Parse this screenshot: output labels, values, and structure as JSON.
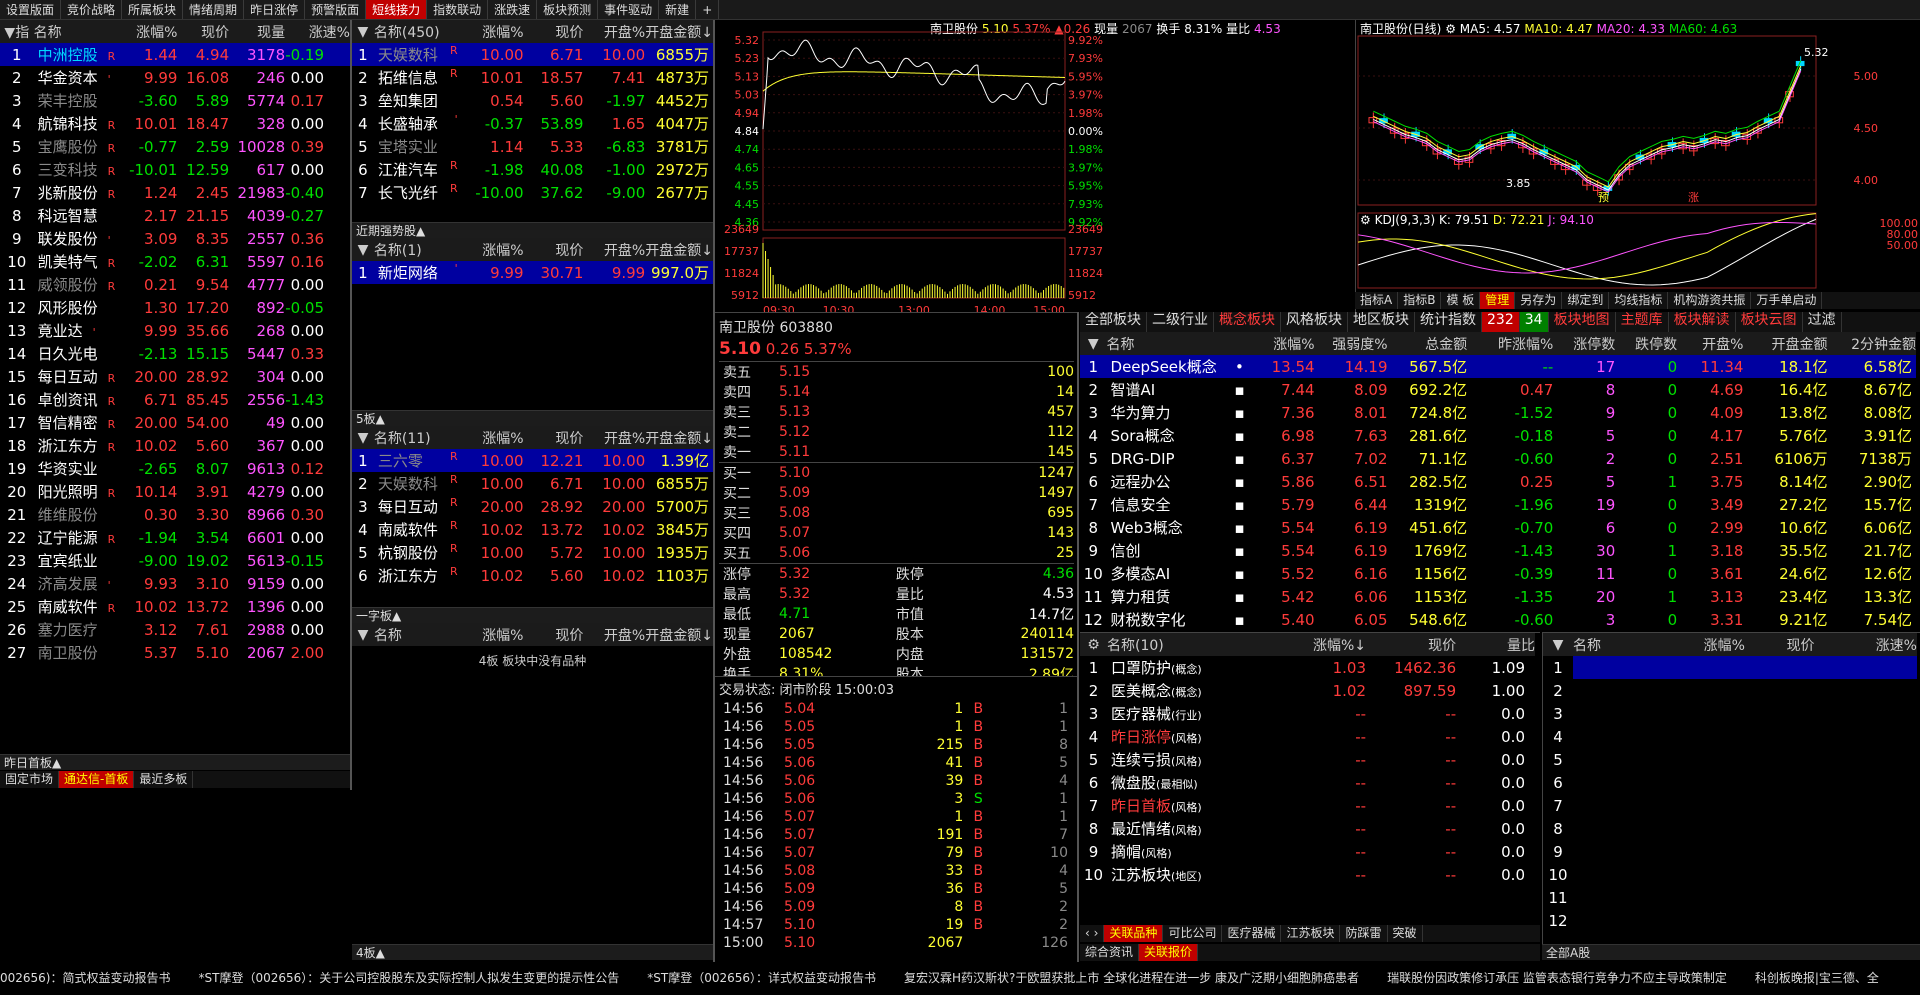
{
  "top_menu": [
    "设置版面",
    "竞价战略",
    "所属板块",
    "情绪周期",
    "昨日涨停",
    "预警版面",
    "短线接力",
    "指数联动",
    "涨跌速",
    "板块预测",
    "事件驱动",
    "新建",
    "+"
  ],
  "left": {
    "headers": [
      "▼指",
      "名称",
      "涨幅%",
      "现价",
      "现量",
      "涨速%"
    ],
    "rows": [
      {
        "i": "1",
        "n": "中洲控股",
        "f": "R",
        "p": "1.44",
        "c": "4.94",
        "v": "3178",
        "s": "-0.19",
        "nc": "cyan",
        "pc": "red",
        "sc": "grn",
        "sel": true
      },
      {
        "i": "2",
        "n": "华金资本",
        "f": "'",
        "p": "9.99",
        "c": "16.08",
        "v": "246",
        "s": "0.00",
        "nc": "wht",
        "pc": "red",
        "sc": "wht"
      },
      {
        "i": "3",
        "n": "荣丰控股",
        "f": "",
        "p": "-3.60",
        "c": "5.89",
        "v": "5774",
        "s": "0.17",
        "nc": "gry",
        "pc": "grn",
        "sc": "red"
      },
      {
        "i": "4",
        "n": "航锦科技",
        "f": "R",
        "p": "10.01",
        "c": "18.47",
        "v": "328",
        "s": "0.00",
        "nc": "wht",
        "pc": "red",
        "sc": "wht"
      },
      {
        "i": "5",
        "n": "宝鹰股份",
        "f": "R",
        "p": "-0.77",
        "c": "2.59",
        "v": "10028",
        "s": "0.39",
        "nc": "gry",
        "pc": "grn",
        "sc": "red"
      },
      {
        "i": "6",
        "n": "三变科技",
        "f": "R",
        "p": "-10.01",
        "c": "12.59",
        "v": "617",
        "s": "0.00",
        "nc": "gry",
        "pc": "grn",
        "sc": "wht"
      },
      {
        "i": "7",
        "n": "兆新股份",
        "f": "R",
        "p": "1.24",
        "c": "2.45",
        "v": "21983",
        "s": "-0.40",
        "nc": "wht",
        "pc": "red",
        "sc": "grn"
      },
      {
        "i": "8",
        "n": "科远智慧",
        "f": "",
        "p": "2.17",
        "c": "21.15",
        "v": "4039",
        "s": "-0.27",
        "nc": "wht",
        "pc": "red",
        "sc": "grn"
      },
      {
        "i": "9",
        "n": "联发股份",
        "f": "'",
        "p": "3.09",
        "c": "8.35",
        "v": "2557",
        "s": "0.36",
        "nc": "wht",
        "pc": "red",
        "sc": "red"
      },
      {
        "i": "10",
        "n": "凯美特气",
        "f": "R",
        "p": "-2.02",
        "c": "6.31",
        "v": "5597",
        "s": "0.16",
        "nc": "wht",
        "pc": "grn",
        "sc": "red"
      },
      {
        "i": "11",
        "n": "威领股份",
        "f": "R",
        "p": "0.21",
        "c": "9.54",
        "v": "4777",
        "s": "0.00",
        "nc": "gry",
        "pc": "red",
        "sc": "wht"
      },
      {
        "i": "12",
        "n": "风形股份",
        "f": "",
        "p": "1.30",
        "c": "17.20",
        "v": "892",
        "s": "-0.05",
        "nc": "wht",
        "pc": "red",
        "sc": "grn"
      },
      {
        "i": "13",
        "n": "竟业达",
        "f": "'",
        "p": "9.99",
        "c": "35.66",
        "v": "268",
        "s": "0.00",
        "nc": "wht",
        "pc": "red",
        "sc": "wht"
      },
      {
        "i": "14",
        "n": "日久光电",
        "f": "",
        "p": "-2.13",
        "c": "15.15",
        "v": "5447",
        "s": "0.33",
        "nc": "wht",
        "pc": "grn",
        "sc": "red"
      },
      {
        "i": "15",
        "n": "每日互动",
        "f": "R",
        "p": "20.00",
        "c": "28.92",
        "v": "304",
        "s": "0.00",
        "nc": "wht",
        "pc": "red",
        "sc": "wht"
      },
      {
        "i": "16",
        "n": "卓创资讯",
        "f": "R",
        "p": "6.71",
        "c": "85.45",
        "v": "2556",
        "s": "-1.43",
        "nc": "wht",
        "pc": "red",
        "sc": "grn"
      },
      {
        "i": "17",
        "n": "智信精密",
        "f": "R",
        "p": "20.00",
        "c": "54.00",
        "v": "49",
        "s": "0.00",
        "nc": "wht",
        "pc": "red",
        "sc": "wht"
      },
      {
        "i": "18",
        "n": "浙江东方",
        "f": "R",
        "p": "10.02",
        "c": "5.60",
        "v": "367",
        "s": "0.00",
        "nc": "wht",
        "pc": "red",
        "sc": "wht"
      },
      {
        "i": "19",
        "n": "华资实业",
        "f": "",
        "p": "-2.65",
        "c": "8.07",
        "v": "9613",
        "s": "0.12",
        "nc": "wht",
        "pc": "grn",
        "sc": "red"
      },
      {
        "i": "20",
        "n": "阳光照明",
        "f": "R",
        "p": "10.14",
        "c": "3.91",
        "v": "4279",
        "s": "0.00",
        "nc": "wht",
        "pc": "red",
        "sc": "wht"
      },
      {
        "i": "21",
        "n": "维维股份",
        "f": "",
        "p": "0.30",
        "c": "3.30",
        "v": "8966",
        "s": "0.30",
        "nc": "gry",
        "pc": "red",
        "sc": "red"
      },
      {
        "i": "22",
        "n": "辽宁能源",
        "f": "R",
        "p": "-1.94",
        "c": "3.54",
        "v": "6601",
        "s": "0.00",
        "nc": "wht",
        "pc": "grn",
        "sc": "wht"
      },
      {
        "i": "23",
        "n": "宜宾纸业",
        "f": "",
        "p": "-9.00",
        "c": "19.02",
        "v": "5613",
        "s": "-0.15",
        "nc": "wht",
        "pc": "grn",
        "sc": "grn"
      },
      {
        "i": "24",
        "n": "济高发展",
        "f": "'",
        "p": "9.93",
        "c": "3.10",
        "v": "9159",
        "s": "0.00",
        "nc": "gry",
        "pc": "red",
        "sc": "wht"
      },
      {
        "i": "25",
        "n": "南威软件",
        "f": "R",
        "p": "10.02",
        "c": "13.72",
        "v": "1396",
        "s": "0.00",
        "nc": "wht",
        "pc": "red",
        "sc": "wht"
      },
      {
        "i": "26",
        "n": "塞力医疗",
        "f": "",
        "p": "3.12",
        "c": "7.61",
        "v": "2988",
        "s": "0.00",
        "nc": "gry",
        "pc": "red",
        "sc": "wht"
      },
      {
        "i": "27",
        "n": "南卫股份",
        "f": "",
        "p": "5.37",
        "c": "5.10",
        "v": "2067",
        "s": "2.00",
        "nc": "gry",
        "pc": "red",
        "sc": "red"
      }
    ],
    "section_label": "昨日首板▲",
    "tabs": [
      "固定市场",
      "通达信-首板",
      "最近多板"
    ]
  },
  "mid": {
    "p1_headers": [
      "▼",
      "名称(450)",
      "涨幅%",
      "现价",
      "开盘%",
      "开盘金额↓"
    ],
    "p1_rows": [
      {
        "i": "1",
        "n": "天娱数科",
        "f": "R",
        "p": "10.00",
        "c": "6.71",
        "o": "10.00",
        "a": "6855万",
        "nc": "gry",
        "pc": "red",
        "oc": "red",
        "sel": true
      },
      {
        "i": "2",
        "n": "拓维信息",
        "f": "R",
        "p": "10.01",
        "c": "18.57",
        "o": "7.41",
        "a": "4873万",
        "nc": "wht",
        "pc": "red",
        "oc": "red"
      },
      {
        "i": "3",
        "n": "垒知集团",
        "f": "",
        "p": "0.54",
        "c": "5.60",
        "o": "-1.97",
        "a": "4452万",
        "nc": "wht",
        "pc": "red",
        "oc": "grn"
      },
      {
        "i": "4",
        "n": "长盛轴承",
        "f": "'",
        "p": "-0.37",
        "c": "53.89",
        "o": "1.65",
        "a": "4047万",
        "nc": "wht",
        "pc": "grn",
        "oc": "red"
      },
      {
        "i": "5",
        "n": "宝塔实业",
        "f": "",
        "p": "1.14",
        "c": "5.33",
        "o": "-6.83",
        "a": "3781万",
        "nc": "gry",
        "pc": "red",
        "oc": "grn"
      },
      {
        "i": "6",
        "n": "江淮汽车",
        "f": "R",
        "p": "-1.98",
        "c": "40.08",
        "o": "-1.00",
        "a": "2972万",
        "nc": "wht",
        "pc": "grn",
        "oc": "grn"
      },
      {
        "i": "7",
        "n": "长飞光纤",
        "f": "R",
        "p": "-10.00",
        "c": "37.62",
        "o": "-9.00",
        "a": "2677万",
        "nc": "wht",
        "pc": "grn",
        "oc": "grn"
      }
    ],
    "s2_label": "近期强势股▲",
    "p2_headers": [
      "▼",
      "名称(1)",
      "涨幅%",
      "现价",
      "开盘%",
      "开盘金额↓"
    ],
    "p2_rows": [
      {
        "i": "1",
        "n": "新炬网络",
        "f": "'",
        "p": "9.99",
        "c": "30.71",
        "o": "9.99",
        "a": "997.0万",
        "nc": "wht",
        "pc": "red",
        "oc": "red",
        "sel": true
      }
    ],
    "s3_label": "5板▲",
    "p3_headers": [
      "▼",
      "名称(11)",
      "涨幅%",
      "现价",
      "开盘%",
      "开盘金额↓"
    ],
    "p3_rows": [
      {
        "i": "1",
        "n": "三六零",
        "f": "R",
        "p": "10.00",
        "c": "12.21",
        "o": "10.00",
        "a": "1.39亿",
        "nc": "gry",
        "pc": "red",
        "oc": "red",
        "sel": true
      },
      {
        "i": "2",
        "n": "天娱数科",
        "f": "R",
        "p": "10.00",
        "c": "6.71",
        "o": "10.00",
        "a": "6855万",
        "nc": "gry",
        "pc": "red",
        "oc": "red"
      },
      {
        "i": "3",
        "n": "每日互动",
        "f": "R",
        "p": "20.00",
        "c": "28.92",
        "o": "20.00",
        "a": "5700万",
        "nc": "wht",
        "pc": "red",
        "oc": "red"
      },
      {
        "i": "4",
        "n": "南威软件",
        "f": "R",
        "p": "10.02",
        "c": "13.72",
        "o": "10.02",
        "a": "3845万",
        "nc": "wht",
        "pc": "red",
        "oc": "red"
      },
      {
        "i": "5",
        "n": "杭钢股份",
        "f": "R",
        "p": "10.00",
        "c": "5.72",
        "o": "10.00",
        "a": "1935万",
        "nc": "wht",
        "pc": "red",
        "oc": "red"
      },
      {
        "i": "6",
        "n": "浙江东方",
        "f": "R",
        "p": "10.02",
        "c": "5.60",
        "o": "10.02",
        "a": "1103万",
        "nc": "wht",
        "pc": "red",
        "oc": "red"
      }
    ],
    "s4_label": "一字板▲",
    "p4_headers": [
      "▼",
      "名称",
      "涨幅%",
      "现价",
      "开盘%",
      "开盘金额↓"
    ],
    "p4_empty": "4板 板块中没有品种",
    "bottom_label": "4板▲"
  },
  "intraday": {
    "header": {
      "name": "南卫股份",
      "price": "5.10",
      "pct": "5.37%",
      "chg": "▲0.26",
      "vol_label": "现量",
      "vol": "2067",
      "turn_label": "换手",
      "turn": "8.31%",
      "qr_label": "量比",
      "qr": "4.53"
    },
    "left_ticks": [
      "5.32",
      "5.23",
      "5.13",
      "5.03",
      "4.94",
      "4.84",
      "4.74",
      "4.65",
      "4.55",
      "4.45",
      "4.36"
    ],
    "right_ticks": [
      "9.92%",
      "7.93%",
      "5.95%",
      "3.97%",
      "1.98%",
      "0.00%",
      "1.98%",
      "3.97%",
      "5.95%",
      "7.93%",
      "9.92%"
    ],
    "vol_ticks": [
      "23649",
      "17737",
      "11824",
      "5912"
    ],
    "times": [
      "09:30",
      "10:30",
      "13:00",
      "14:00",
      "15:00"
    ]
  },
  "kline": {
    "header": {
      "name": "南卫股份(日线)",
      "ma5": "MA5: 4.57",
      "ma10": "MA10: 4.47",
      "ma20": "MA20: 4.33",
      "ma60": "MA60: 4.63"
    },
    "ticks": [
      "5.00",
      "4.50",
      "4.00"
    ],
    "hi": "5.32",
    "lo": "3.85",
    "kdj": {
      "label": "KDJ(9,3,3)",
      "k": "K: 79.51",
      "d": "D: 72.21",
      "j": "J: 94.10"
    },
    "kdj_ticks": [
      "100.00",
      "80.00",
      "50.00"
    ],
    "year": "2024年",
    "day_tab": "日线",
    "mark_yu": "预",
    "mark_zhang": "涨",
    "mark_2": "2",
    "tabs": [
      "指标A",
      "指标B",
      "模 板",
      "管理",
      "另存为",
      "绑定到",
      "均线指标",
      "机构游资共振",
      "万手单启动"
    ]
  },
  "quote": {
    "title": "南卫股份 603880",
    "price": "5.10",
    "chg": "0.26",
    "pct": "5.37%",
    "asks": [
      [
        "卖五",
        "5.15",
        "100"
      ],
      [
        "卖四",
        "5.14",
        "14"
      ],
      [
        "卖三",
        "5.13",
        "457"
      ],
      [
        "卖二",
        "5.12",
        "112"
      ],
      [
        "卖一",
        "5.11",
        "145"
      ]
    ],
    "bids": [
      [
        "买一",
        "5.10",
        "1247"
      ],
      [
        "买二",
        "5.09",
        "1497"
      ],
      [
        "买三",
        "5.08",
        "695"
      ],
      [
        "买四",
        "5.07",
        "143"
      ],
      [
        "买五",
        "5.06",
        "25"
      ]
    ],
    "stats": [
      [
        "涨停",
        "5.32",
        "跌停",
        "4.36"
      ],
      [
        "最高",
        "5.32",
        "量比",
        "4.53"
      ],
      [
        "最低",
        "4.71",
        "市值",
        "14.7亿"
      ],
      [
        "现量",
        "2067",
        "股本",
        "240114"
      ],
      [
        "外盘",
        "108542",
        "内盘",
        "131572"
      ],
      [
        "换手",
        "8.31%",
        "股本",
        "2.89亿"
      ]
    ],
    "status": "交易状态: 闭市阶段 15:00:03",
    "trades": [
      [
        "14:56",
        "5.04",
        "1",
        "B",
        "1"
      ],
      [
        "14:56",
        "5.05",
        "1",
        "B",
        "1"
      ],
      [
        "14:56",
        "5.05",
        "215",
        "B",
        "8"
      ],
      [
        "14:56",
        "5.06",
        "41",
        "B",
        "5"
      ],
      [
        "14:56",
        "5.06",
        "39",
        "B",
        "4"
      ],
      [
        "14:56",
        "5.06",
        "3",
        "S",
        "1"
      ],
      [
        "14:56",
        "5.07",
        "1",
        "B",
        "1"
      ],
      [
        "14:56",
        "5.07",
        "191",
        "B",
        "7"
      ],
      [
        "14:56",
        "5.07",
        "79",
        "B",
        "10"
      ],
      [
        "14:56",
        "5.08",
        "33",
        "B",
        "4"
      ],
      [
        "14:56",
        "5.09",
        "36",
        "B",
        "5"
      ],
      [
        "14:56",
        "5.09",
        "8",
        "B",
        "2"
      ],
      [
        "14:57",
        "5.10",
        "19",
        "B",
        "2"
      ],
      [
        "15:00",
        "5.10",
        "2067",
        "",
        "126"
      ]
    ]
  },
  "sector": {
    "tabs": [
      "全部板块",
      "二级行业",
      "概念板块",
      "风格板块",
      "地区板块",
      "统计指数",
      "232",
      "34",
      "板块地图",
      "主题库",
      "板块解读",
      "板块云图",
      "过滤"
    ],
    "headers": [
      "▼",
      "名称",
      "",
      "涨幅%",
      "强弱度%",
      "总金额",
      "昨涨幅%",
      "涨停数",
      "跌停数",
      "开盘%",
      "开盘金额",
      "2分钟金额"
    ],
    "rows": [
      [
        "1",
        "DeepSeek概念",
        "13.54",
        "14.19",
        "567.5亿",
        "--",
        "17",
        "0",
        "11.34",
        "18.1亿",
        "6.58亿"
      ],
      [
        "2",
        "智谱AI",
        "7.44",
        "8.09",
        "692.2亿",
        "0.47",
        "8",
        "0",
        "4.69",
        "16.4亿",
        "8.67亿"
      ],
      [
        "3",
        "华为算力",
        "7.36",
        "8.01",
        "724.8亿",
        "-1.52",
        "9",
        "0",
        "4.09",
        "13.8亿",
        "8.08亿"
      ],
      [
        "4",
        "Sora概念",
        "6.98",
        "7.63",
        "281.6亿",
        "-0.18",
        "5",
        "0",
        "4.17",
        "5.76亿",
        "3.91亿"
      ],
      [
        "5",
        "DRG-DIP",
        "6.37",
        "7.02",
        "71.1亿",
        "-0.60",
        "2",
        "0",
        "2.51",
        "6106万",
        "7138万"
      ],
      [
        "6",
        "远程办公",
        "5.86",
        "6.51",
        "282.5亿",
        "0.25",
        "5",
        "1",
        "3.75",
        "8.14亿",
        "2.90亿"
      ],
      [
        "7",
        "信息安全",
        "5.79",
        "6.44",
        "1319亿",
        "-1.96",
        "19",
        "0",
        "3.49",
        "27.2亿",
        "15.7亿"
      ],
      [
        "8",
        "Web3概念",
        "5.54",
        "6.19",
        "451.6亿",
        "-0.70",
        "6",
        "0",
        "2.99",
        "10.6亿",
        "6.06亿"
      ],
      [
        "9",
        "信创",
        "5.54",
        "6.19",
        "1769亿",
        "-1.43",
        "30",
        "1",
        "3.18",
        "35.5亿",
        "21.7亿"
      ],
      [
        "10",
        "多模态AI",
        "5.52",
        "6.16",
        "1156亿",
        "-0.39",
        "11",
        "0",
        "3.61",
        "24.6亿",
        "12.6亿"
      ],
      [
        "11",
        "算力租赁",
        "5.42",
        "6.06",
        "1153亿",
        "-1.35",
        "20",
        "1",
        "3.13",
        "23.4亿",
        "13.3亿"
      ],
      [
        "12",
        "财税数字化",
        "5.40",
        "6.05",
        "548.6亿",
        "-0.60",
        "3",
        "0",
        "3.31",
        "9.21亿",
        "7.54亿"
      ]
    ]
  },
  "related": {
    "headers": [
      "名称(10)",
      "涨幅%↓",
      "现价",
      "量比"
    ],
    "rows": [
      [
        "1",
        "口罩防护",
        "(概念)",
        "1.03",
        "1462.36",
        "1.09",
        "wht"
      ],
      [
        "2",
        "医美概念",
        "(概念)",
        "1.02",
        "897.59",
        "1.00",
        "wht"
      ],
      [
        "3",
        "医疗器械",
        "(行业)",
        "--",
        "--",
        "0.0",
        "wht"
      ],
      [
        "4",
        "昨日涨停",
        "(风格)",
        "--",
        "--",
        "0.0",
        "red"
      ],
      [
        "5",
        "连续亏损",
        "(风格)",
        "--",
        "--",
        "0.0",
        "wht"
      ],
      [
        "6",
        "微盘股",
        "(最相似)",
        "--",
        "--",
        "0.0",
        "wht"
      ],
      [
        "7",
        "昨日首板",
        "(风格)",
        "--",
        "--",
        "0.0",
        "red"
      ],
      [
        "8",
        "最近情绪",
        "(风格)",
        "--",
        "--",
        "0.0",
        "wht"
      ],
      [
        "9",
        "摘帽",
        "(风格)",
        "--",
        "--",
        "0.0",
        "wht"
      ],
      [
        "10",
        "江苏板块",
        "(地区)",
        "--",
        "--",
        "0.0",
        "wht"
      ]
    ],
    "tabs": [
      "关联品种",
      "可比公司",
      "医疗器械",
      "江苏板块",
      "防踩雷",
      "突破"
    ],
    "tabs2": [
      "综合资讯",
      "关联报价"
    ]
  },
  "mini": {
    "headers": [
      "名称",
      "涨幅%",
      "现价",
      "涨速%"
    ],
    "nums": [
      "1",
      "2",
      "3",
      "4",
      "5",
      "6",
      "7",
      "8",
      "9",
      "10",
      "11",
      "12"
    ],
    "footer": "全部A股"
  },
  "ticker": [
    "002656)：简式权益变动报告书",
    "*ST摩登（002656）：关于公司控股股东及实际控制人拟发生变更的提示性公告",
    "*ST摩登（002656）：详式权益变动报告书",
    "复宏汉霖H药汉斯状?于欧盟获批上市 全球化进程在进一步 康及广泛期小细胞肺癌患者",
    "瑞联股份因政策修订承压 监管表态银行竞争力不应主导政策制定",
    "科创板晚报|宝三德、全"
  ],
  "colors": {
    "up": "#ff3b3b",
    "down": "#00e000",
    "select": "#0000a0",
    "accent": "#c00000"
  }
}
